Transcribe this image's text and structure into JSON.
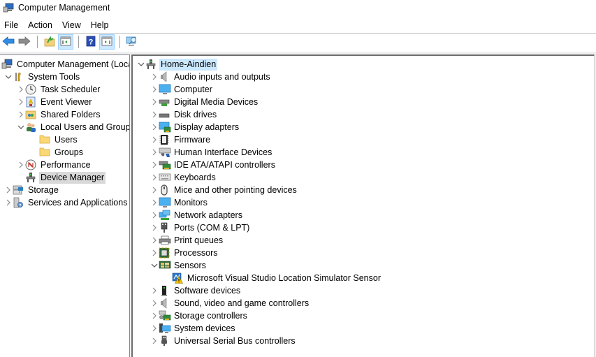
{
  "window": {
    "title": "Computer Management",
    "icon": "computer-management-icon"
  },
  "menubar": {
    "items": [
      {
        "label": "File"
      },
      {
        "label": "Action"
      },
      {
        "label": "View"
      },
      {
        "label": "Help"
      }
    ]
  },
  "toolbar": {
    "buttons": [
      {
        "name": "back-button",
        "icon": "arrow-left-icon"
      },
      {
        "name": "forward-button",
        "icon": "arrow-right-icon"
      },
      {
        "name": "up-one-level-button",
        "icon": "folder-up-icon"
      },
      {
        "name": "show-hide-console-tree-button",
        "icon": "console-tree-icon",
        "active": true
      },
      {
        "name": "help-button",
        "icon": "help-icon"
      },
      {
        "name": "show-hide-action-pane-button",
        "icon": "action-pane-icon",
        "active": true
      },
      {
        "name": "scan-hardware-button",
        "icon": "scan-monitor-icon"
      }
    ]
  },
  "console_tree": {
    "items": [
      {
        "label": "Computer Management (Local",
        "icon": "computer-management-icon",
        "level": 0,
        "expander": "none"
      },
      {
        "label": "System Tools",
        "icon": "tools-icon",
        "level": 1,
        "expander": "expanded"
      },
      {
        "label": "Task Scheduler",
        "icon": "clock-icon",
        "level": 2,
        "expander": "collapsed"
      },
      {
        "label": "Event Viewer",
        "icon": "event-viewer-icon",
        "level": 2,
        "expander": "collapsed"
      },
      {
        "label": "Shared Folders",
        "icon": "shared-folder-icon",
        "level": 2,
        "expander": "collapsed"
      },
      {
        "label": "Local Users and Groups",
        "icon": "users-icon",
        "level": 2,
        "expander": "expanded"
      },
      {
        "label": "Users",
        "icon": "folder-icon",
        "level": 3,
        "expander": "none"
      },
      {
        "label": "Groups",
        "icon": "folder-icon",
        "level": 3,
        "expander": "none"
      },
      {
        "label": "Performance",
        "icon": "performance-icon",
        "level": 2,
        "expander": "collapsed"
      },
      {
        "label": "Device Manager",
        "icon": "device-manager-icon",
        "level": 2,
        "expander": "none",
        "selected": true
      },
      {
        "label": "Storage",
        "icon": "storage-icon",
        "level": 1,
        "expander": "collapsed"
      },
      {
        "label": "Services and Applications",
        "icon": "services-icon",
        "level": 1,
        "expander": "collapsed"
      }
    ]
  },
  "device_tree": {
    "root": {
      "label": "Home-Aindien",
      "icon": "device-manager-icon",
      "expander": "expanded",
      "selected": true
    },
    "items": [
      {
        "label": "Audio inputs and outputs",
        "icon": "speaker-icon",
        "expander": "collapsed"
      },
      {
        "label": "Computer",
        "icon": "monitor-icon",
        "expander": "collapsed"
      },
      {
        "label": "Digital Media Devices",
        "icon": "media-device-icon",
        "expander": "collapsed"
      },
      {
        "label": "Disk drives",
        "icon": "disk-drive-icon",
        "expander": "collapsed"
      },
      {
        "label": "Display adapters",
        "icon": "display-adapter-icon",
        "expander": "collapsed"
      },
      {
        "label": "Firmware",
        "icon": "chip-icon",
        "expander": "collapsed"
      },
      {
        "label": "Human Interface Devices",
        "icon": "hid-icon",
        "expander": "collapsed"
      },
      {
        "label": "IDE ATA/ATAPI controllers",
        "icon": "ide-controller-icon",
        "expander": "collapsed"
      },
      {
        "label": "Keyboards",
        "icon": "keyboard-icon",
        "expander": "collapsed"
      },
      {
        "label": "Mice and other pointing devices",
        "icon": "mouse-icon",
        "expander": "collapsed"
      },
      {
        "label": "Monitors",
        "icon": "monitor-icon",
        "expander": "collapsed"
      },
      {
        "label": "Network adapters",
        "icon": "network-icon",
        "expander": "collapsed"
      },
      {
        "label": "Ports (COM & LPT)",
        "icon": "port-icon",
        "expander": "collapsed"
      },
      {
        "label": "Print queues",
        "icon": "printer-icon",
        "expander": "collapsed"
      },
      {
        "label": "Processors",
        "icon": "processor-icon",
        "expander": "collapsed"
      },
      {
        "label": "Sensors",
        "icon": "sensor-icon",
        "expander": "expanded"
      },
      {
        "label": "Microsoft Visual Studio Location Simulator Sensor",
        "icon": "sensor-warning-icon",
        "expander": "none",
        "child": true
      },
      {
        "label": "Software devices",
        "icon": "software-device-icon",
        "expander": "collapsed"
      },
      {
        "label": "Sound, video and game controllers",
        "icon": "speaker-icon",
        "expander": "collapsed"
      },
      {
        "label": "Storage controllers",
        "icon": "storage-controller-icon",
        "expander": "collapsed"
      },
      {
        "label": "System devices",
        "icon": "system-device-icon",
        "expander": "collapsed"
      },
      {
        "label": "Universal Serial Bus controllers",
        "icon": "usb-icon",
        "expander": "collapsed"
      }
    ]
  },
  "colors": {
    "selection_blue": "#cce8ff",
    "selection_grey": "#d9d9d9",
    "toolbar_active": "#cce8ff"
  }
}
